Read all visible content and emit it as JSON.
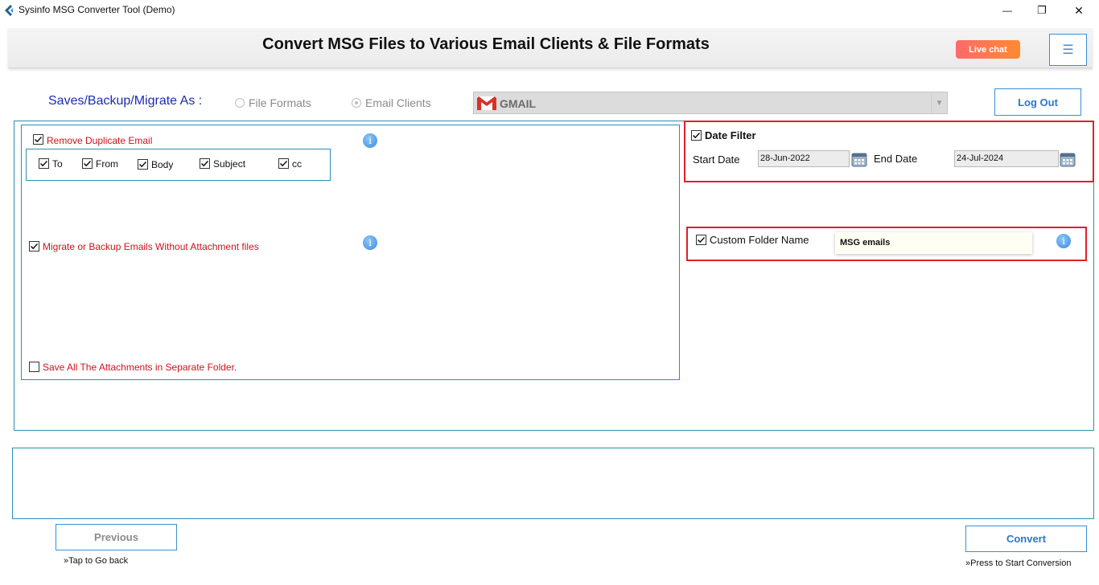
{
  "window": {
    "title": "Sysinfo MSG Converter Tool (Demo)",
    "minimize": "—",
    "restore": "❐",
    "close": "✕"
  },
  "header": {
    "title": "Convert MSG Files to Various Email Clients & File Formats",
    "live_chat": "Live chat",
    "menu_icon": "☰"
  },
  "save_as": {
    "label": "Saves/Backup/Migrate As :",
    "options": [
      {
        "label": "File Formats",
        "selected": false
      },
      {
        "label": "Email Clients",
        "selected": true
      }
    ],
    "selected_client": "GMAIL",
    "dropdown_icon": "chevron-down-icon"
  },
  "logout_label": "Log Out",
  "options": {
    "remove_duplicate": {
      "label": "Remove Duplicate Email",
      "checked": true
    },
    "duplicate_fields": [
      {
        "label": "To",
        "checked": true
      },
      {
        "label": "From",
        "checked": true
      },
      {
        "label": "Body",
        "checked": true
      },
      {
        "label": "Subject",
        "checked": true
      },
      {
        "label": "cc",
        "checked": true
      }
    ],
    "without_attachments": {
      "label": "Migrate or Backup Emails Without Attachment files",
      "checked": true
    },
    "save_attachments": {
      "label": "Save All The Attachments in Separate Folder.",
      "checked": false
    },
    "info_glyph": "i"
  },
  "date_filter": {
    "label": "Date Filter",
    "checked": true,
    "start_label": "Start Date",
    "start_value": "28-Jun-2022",
    "end_label": "End Date",
    "end_value": "24-Jul-2024"
  },
  "custom_folder": {
    "label": "Custom Folder Name",
    "checked": true,
    "value": "MSG emails"
  },
  "footer": {
    "previous_label": "Previous",
    "previous_hint": "»Tap to Go back",
    "convert_label": "Convert",
    "convert_hint": "»Press to Start Conversion"
  },
  "colors": {
    "accent_blue": "#3a8fd6",
    "panel_border": "#2b8fb3",
    "highlight_red": "#e0202a",
    "label_red": "#d0121b",
    "title_blue": "#1a2bb5"
  }
}
